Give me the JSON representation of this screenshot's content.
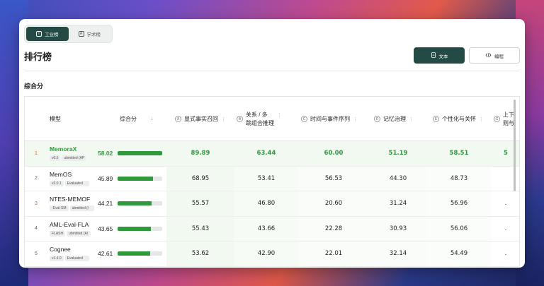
{
  "tabs": [
    {
      "label": "工业榜",
      "icon": "I",
      "active": true
    },
    {
      "label": "学术榜",
      "icon": "A",
      "active": false
    }
  ],
  "page_title": "排行榜",
  "buttons": {
    "text": "文本",
    "code": "编程"
  },
  "section_title": "综合分",
  "columns": {
    "model": "模型",
    "overall": "综合分",
    "a": {
      "badge": "A",
      "label": "显式事实召回"
    },
    "b": {
      "badge": "B",
      "label_line1": "关系 / 多",
      "label_line2": "跳组合推理"
    },
    "c": {
      "badge": "C",
      "label": "时间与事件序列"
    },
    "d": {
      "badge": "D",
      "label": "记忆治理"
    },
    "e": {
      "badge": "E",
      "label": "个性化与关怀"
    },
    "g": {
      "badge": "G",
      "label_line1": "上下",
      "label_line2": "则与"
    }
  },
  "rows": [
    {
      "rank": "1",
      "name": "MemoraX",
      "tag1": "v0.5",
      "tag2": "ubmitted (AP",
      "overall": "58.02",
      "overall_pct": 100,
      "a": "89.89",
      "b": "63.44",
      "c": "60.00",
      "d": "51.19",
      "e": "58.51",
      "g": "5"
    },
    {
      "rank": "2",
      "name": "MemOS",
      "tag1": "v2.0.1",
      "tag2": "Evaluated",
      "overall": "45.89",
      "overall_pct": 79,
      "a": "68.95",
      "b": "53.41",
      "c": "56.53",
      "d": "44.30",
      "e": "48.73",
      "g": ""
    },
    {
      "rank": "3",
      "name": "NTES-MEMOF",
      "tag1": "-Eval-SM",
      "tag2": "ubmitted (/",
      "overall": "44.21",
      "overall_pct": 76,
      "a": "55.57",
      "b": "46.80",
      "c": "20.60",
      "d": "31.24",
      "e": "56.96",
      "g": "."
    },
    {
      "rank": "4",
      "name": "AML-Eval-FLA",
      "tag1": "FLASH",
      "tag2": "ubmitted (AI",
      "overall": "43.65",
      "overall_pct": 75,
      "a": "55.43",
      "b": "43.66",
      "c": "22.28",
      "d": "30.93",
      "e": "56.06",
      "g": "."
    },
    {
      "rank": "5",
      "name": "Cognee",
      "tag1": "v1.4.0",
      "tag2": "Evaluated",
      "overall": "42.61",
      "overall_pct": 73,
      "a": "53.62",
      "b": "42.90",
      "c": "22.01",
      "d": "32.14",
      "e": "54.49",
      "g": "."
    }
  ],
  "colors": {
    "accent": "#234a44",
    "win": "#2e9a3c"
  }
}
